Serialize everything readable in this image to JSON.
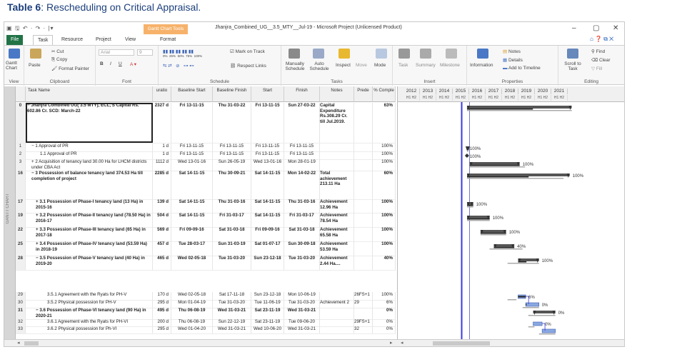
{
  "caption": {
    "label": "Table 6",
    "text": ": Rescheduling on Critical Appraisal."
  },
  "titlebar": {
    "qat": "▣ 🖫 ↶ · ↷ · |▾",
    "context_tab": "Gantt Chart Tools",
    "title": "Jhanjra_Combined_UG__3.5_MTY__Jul-19 - Microsoft Project (Unlicensed Product)"
  },
  "tabs": [
    "File",
    "Task",
    "Resource",
    "Project",
    "View",
    "Format"
  ],
  "ribbon": {
    "view_group": {
      "button": "Gantt Chart",
      "label": "View"
    },
    "clipboard": {
      "paste": "Paste",
      "cut": "Cut",
      "copy": "Copy",
      "format_painter": "Format Painter",
      "label": "Clipboard"
    },
    "font": {
      "font_name": "Arial",
      "font_size": "9",
      "bold": "B",
      "italic": "I",
      "underline": "U",
      "label": "Font"
    },
    "schedule": {
      "mark_on_track": "Mark on Track",
      "respect_links": "Respect Links",
      "pct": [
        "0%",
        "25%",
        "50%",
        "75%",
        "100%"
      ],
      "label": "Schedule"
    },
    "tasks": {
      "manually": "Manually Schedule",
      "auto": "Auto Schedule",
      "inspect": "Inspect",
      "move": "Move",
      "mode": "Mode",
      "label": "Tasks"
    },
    "insert": {
      "task": "Task",
      "summary": "Summary",
      "milestone": "Milestone",
      "label": "Insert"
    },
    "properties": {
      "information": "Information",
      "notes": "Notes",
      "details": "Details",
      "add_timeline": "Add to Timeline",
      "label": "Properties"
    },
    "editing": {
      "scroll": "Scroll to Task",
      "find": "Find",
      "clear": "Clear",
      "fill": "Fill",
      "label": "Editing"
    }
  },
  "sidebar_label": "GANTT CHART",
  "columns": [
    "",
    "Task Name",
    "uratio",
    "Baseline Start",
    "Baseline Finish",
    "Start",
    "Finish",
    "Notes",
    "Prede",
    "% Comple"
  ],
  "rows": [
    {
      "id": "0",
      "name": "− Jhanjra Combined UG( 3.5 MTY), ECL, S Capital Rs. 602.86 Cr. SCD: March-22",
      "dur": "2327 d",
      "bstart": "Fri 13-11-15",
      "bfinish": "Thu 31-03-22",
      "start": "Fri 13-11-15",
      "finish": "Sun 27-03-22",
      "notes": "Capital Expenditure Rs.308.29 Cr. till Jul.2019.",
      "pred": "",
      "pct": "63%"
    },
    {
      "id": "1",
      "name": "− 1 Approval of PR",
      "dur": "1 d",
      "bstart": "Fri 13-11-15",
      "bfinish": "Fri 13-11-15",
      "start": "Fri 13-11-15",
      "finish": "Fri 13-11-15",
      "notes": "",
      "pred": "",
      "pct": "100%"
    },
    {
      "id": "2",
      "name": "1.1 Approval of PR",
      "dur": "1 d",
      "bstart": "Fri 13-11-15",
      "bfinish": "Fri 13-11-15",
      "start": "Fri 13-11-15",
      "finish": "Fri 13-11-15",
      "notes": "",
      "pred": "",
      "pct": "100%"
    },
    {
      "id": "3",
      "name": "+ 2 Acquisition of tenancy land 30.00 Ha for LHCM districts under CBA Act",
      "dur": "1112 d",
      "bstart": "Wed 13-01-16",
      "bfinish": "Sun 26-05-19",
      "start": "Wed 13-01-16",
      "finish": "Mon 28-01-19",
      "notes": "",
      "pred": "",
      "pct": "100%"
    },
    {
      "id": "16",
      "name": "− 3 Possession of balance tenancy land 374.53 Ha till completion of project",
      "dur": "2285 d",
      "bstart": "Sat 14-11-15",
      "bfinish": "Thu 30-09-21",
      "start": "Sat 14-11-15",
      "finish": "Mon 14-02-22",
      "notes": "Total achievement 213.11 Ha",
      "pred": "",
      "pct": "60%"
    },
    {
      "id": "17",
      "name": "+ 3.1 Possession of Phase-I tenancy land (13 Ha) in 2015-16",
      "dur": "139 d",
      "bstart": "Sat 14-11-15",
      "bfinish": "Thu 31-03-16",
      "start": "Sat 14-11-15",
      "finish": "Thu 31-03-16",
      "notes": "Achievement 12.96 Ha",
      "pred": "",
      "pct": "100%"
    },
    {
      "id": "19",
      "name": "+ 3.2 Possession of Phase-II tenancy land (78.50 Ha) in 2016-17",
      "dur": "504 d",
      "bstart": "Sat 14-11-15",
      "bfinish": "Fri 31-03-17",
      "start": "Sat 14-11-15",
      "finish": "Fri 31-03-17",
      "notes": "Achievement 78.54 Ha",
      "pred": "",
      "pct": "100%"
    },
    {
      "id": "22",
      "name": "+ 3.3 Possession of Phase-III tenancy land (65 Ha) in 2017-18",
      "dur": "569 d",
      "bstart": "Fri 09-09-16",
      "bfinish": "Sat 31-03-18",
      "start": "Fri 09-09-16",
      "finish": "Sat 31-03-18",
      "notes": "Achievement 65.58 Ha",
      "pred": "",
      "pct": "100%"
    },
    {
      "id": "25",
      "name": "+ 3.4 Possession of Phase-IV tenancy land (53.59 Ha) in 2018-19",
      "dur": "457 d",
      "bstart": "Tue 28-03-17",
      "bfinish": "Sun 31-03-19",
      "start": "Sat 01-07-17",
      "finish": "Sun 30-09-18",
      "notes": "Achievement 53.59 Ha",
      "pred": "",
      "pct": "100%"
    },
    {
      "id": "28",
      "name": "− 3.5 Possession of Phase-V tenancy land (40 Ha) in 2019-20",
      "dur": "465 d",
      "bstart": "Wed 02-05-18",
      "bfinish": "Tue 31-03-20",
      "start": "Sun 23-12-18",
      "finish": "Tue 31-03-20",
      "notes": "Achievement 2.44 Ha....",
      "pred": "",
      "pct": "40%"
    },
    {
      "id": "29",
      "name": "3.5.1 Agreement with the Ryats for PH-V",
      "dur": "170 d",
      "bstart": "Wed 02-05-18",
      "bfinish": "Sat 17-11-18",
      "start": "Sun 23-12-18",
      "finish": "Mon 10-06-19",
      "notes": "",
      "pred": "26FS+1",
      "pct": "100%"
    },
    {
      "id": "30",
      "name": "3.5.2 Physical possession for PH-V",
      "dur": "295 d",
      "bstart": "Mon 01-04-19",
      "bfinish": "Tue 31-03-20",
      "start": "Tue 11-06-19",
      "finish": "Tue 31-03-20",
      "notes": "Achievement 2",
      "pred": "29",
      "pct": "6%"
    },
    {
      "id": "31",
      "name": "− 3.6 Possession of Phase-VI tenancy land (90 Ha) in 2020-21",
      "dur": "495 d",
      "bstart": "Thu 06-08-19",
      "bfinish": "Wed 31-03-21",
      "start": "Sat 23-11-19",
      "finish": "Wed 31-03-21",
      "notes": "",
      "pred": "",
      "pct": "0%"
    },
    {
      "id": "32",
      "name": "3.6.1 Agreement with the Ryats for PH-VI",
      "dur": "200 d",
      "bstart": "Thu 06-08-19",
      "bfinish": "Sun 22-12-19",
      "start": "Sat 23-11-19",
      "finish": "Tue 09-06-20",
      "notes": "",
      "pred": "29FS+1",
      "pct": "0%"
    },
    {
      "id": "33",
      "name": "3.6.2 Physical possession for Ph-VI",
      "dur": "295 d",
      "bstart": "Wed 01-04-20",
      "bfinish": "Wed 31-03-21",
      "start": "Wed 10-06-20",
      "finish": "Wed 31-03-21",
      "notes": "",
      "pred": "32",
      "pct": "0%"
    }
  ],
  "timeline": {
    "years": [
      "2012",
      "2013",
      "2014",
      "2015",
      "2016",
      "2017",
      "2018",
      "2019",
      "2020",
      "2021"
    ],
    "half": "H1 H2"
  },
  "gantt_labels": [
    "100%",
    "100%",
    "100%",
    "100%",
    "100%",
    "100%",
    "100%",
    "40%",
    "100%",
    "6%",
    "0%",
    "0%",
    "0%"
  ]
}
